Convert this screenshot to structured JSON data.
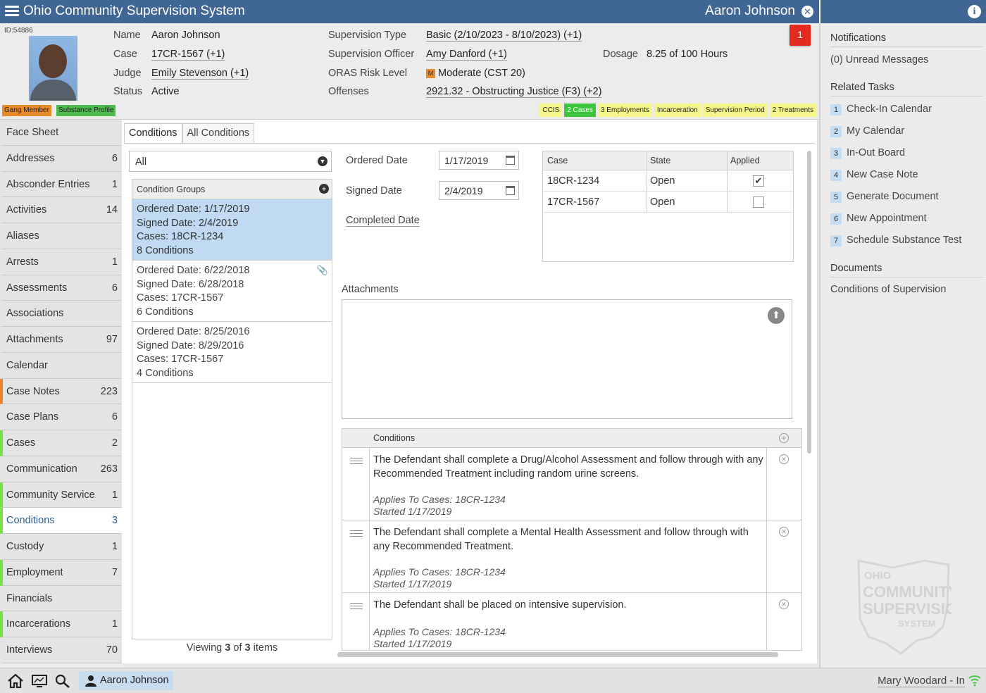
{
  "app": {
    "title": "Ohio Community Supervision System",
    "client_name": "Aaron Johnson"
  },
  "header": {
    "id_label": "ID:54886",
    "tags": [
      "Gang Member",
      "Substance Profile"
    ],
    "name_label": "Name",
    "name_value": "Aaron Johnson",
    "case_label": "Case",
    "case_value": "17CR-1567 (+1)",
    "judge_label": "Judge",
    "judge_value": "Emily Stevenson (+1)",
    "status_label": "Status",
    "status_value": "Active",
    "sup_type_label": "Supervision Type",
    "sup_type_value": "Basic (2/10/2023 - 8/10/2023) (+1)",
    "officer_label": "Supervision Officer",
    "officer_value": "Amy Danford (+1)",
    "oras_label": "ORAS Risk Level",
    "oras_badge": "M",
    "oras_value": "Moderate (CST 20)",
    "offenses_label": "Offenses",
    "offenses_value": "2921.32 - Obstructing Justice (F3) (+2)",
    "dosage_label": "Dosage",
    "dosage_value": "8.25 of 100 Hours",
    "alert_count": "1",
    "chips": [
      "CCIS",
      "2 Cases",
      "3 Employments",
      "Incarceration",
      "Supervision Period",
      "2 Treatments"
    ]
  },
  "nav": [
    {
      "label": "Face Sheet",
      "count": ""
    },
    {
      "label": "Addresses",
      "count": "6"
    },
    {
      "label": "Absconder Entries",
      "count": "1"
    },
    {
      "label": "Activities",
      "count": "14"
    },
    {
      "label": "Aliases",
      "count": ""
    },
    {
      "label": "Arrests",
      "count": "1"
    },
    {
      "label": "Assessments",
      "count": "6"
    },
    {
      "label": "Associations",
      "count": ""
    },
    {
      "label": "Attachments",
      "count": "97"
    },
    {
      "label": "Calendar",
      "count": ""
    },
    {
      "label": "Case Notes",
      "count": "223"
    },
    {
      "label": "Case Plans",
      "count": "6"
    },
    {
      "label": "Cases",
      "count": "2"
    },
    {
      "label": "Communication",
      "count": "263"
    },
    {
      "label": "Community Service",
      "count": "1"
    },
    {
      "label": "Conditions",
      "count": "3"
    },
    {
      "label": "Custody",
      "count": "1"
    },
    {
      "label": "Employment",
      "count": "7"
    },
    {
      "label": "Financials",
      "count": ""
    },
    {
      "label": "Incarcerations",
      "count": "1"
    },
    {
      "label": "Interviews",
      "count": "70"
    }
  ],
  "main": {
    "tabs": [
      "Conditions",
      "All Conditions"
    ],
    "filter_value": "All",
    "groups_header": "Condition Groups",
    "groups": [
      {
        "ordered": "Ordered Date: 1/17/2019",
        "signed": "Signed Date: 2/4/2019",
        "cases": "Cases: 18CR-1234",
        "count": "8 Conditions"
      },
      {
        "ordered": "Ordered Date: 6/22/2018",
        "signed": "Signed Date: 6/28/2018",
        "cases": "Cases: 17CR-1567",
        "count": "6 Conditions"
      },
      {
        "ordered": "Ordered Date: 8/25/2016",
        "signed": "Signed Date: 8/29/2016",
        "cases": "Cases: 17CR-1567",
        "count": "4 Conditions"
      }
    ],
    "viewing": {
      "prefix": "Viewing",
      "shown": "3",
      "of": "of",
      "total": "3",
      "suffix": "items"
    },
    "ordered_label": "Ordered Date",
    "ordered_value": "1/17/2019",
    "signed_label": "Signed Date",
    "signed_value": "2/4/2019",
    "completed_label": "Completed Date",
    "case_table": {
      "headers": [
        "Case",
        "State",
        "Applied"
      ],
      "rows": [
        {
          "case": "18CR-1234",
          "state": "Open",
          "applied": true
        },
        {
          "case": "17CR-1567",
          "state": "Open",
          "applied": false
        }
      ]
    },
    "attachments_label": "Attachments",
    "conditions_header": "Conditions",
    "conditions": [
      {
        "text": "The Defendant shall complete a Drug/Alcohol Assessment and follow through with any Recommended Treatment including random urine screens.",
        "applies": "Applies To Cases: 18CR-1234",
        "started": "Started 1/17/2019"
      },
      {
        "text": "The Defendant shall complete a Mental Health Assessment and follow through with any Recommended Treatment.",
        "applies": "Applies To Cases: 18CR-1234",
        "started": "Started 1/17/2019"
      },
      {
        "text": "The Defendant shall be placed on intensive supervision.",
        "applies": "Applies To Cases: 18CR-1234",
        "started": "Started 1/17/2019"
      }
    ]
  },
  "right": {
    "notifications_title": "Notifications",
    "unread": "(0) Unread Messages",
    "tasks_title": "Related Tasks",
    "tasks": [
      "Check-In Calendar",
      "My Calendar",
      "In-Out Board",
      "New Case Note",
      "Generate Document",
      "New Appointment",
      "Schedule Substance Test"
    ],
    "documents_title": "Documents",
    "documents": [
      "Conditions of Supervision"
    ],
    "watermark": [
      "OHIO",
      "COMMUNITY",
      "SUPERVISION",
      "SYSTEM"
    ]
  },
  "bottom": {
    "person": "Aaron Johnson",
    "user": "Mary Woodard - In"
  },
  "colors": {
    "header_blue": "#3f6695",
    "alert_red": "#e22b1e",
    "selected_group": "#bfdaf2",
    "chip_yellow": "#f6f58a",
    "chip_green": "#3cc43c",
    "tag_orange": "#e8892a",
    "tag_green": "#4dbb4d"
  }
}
